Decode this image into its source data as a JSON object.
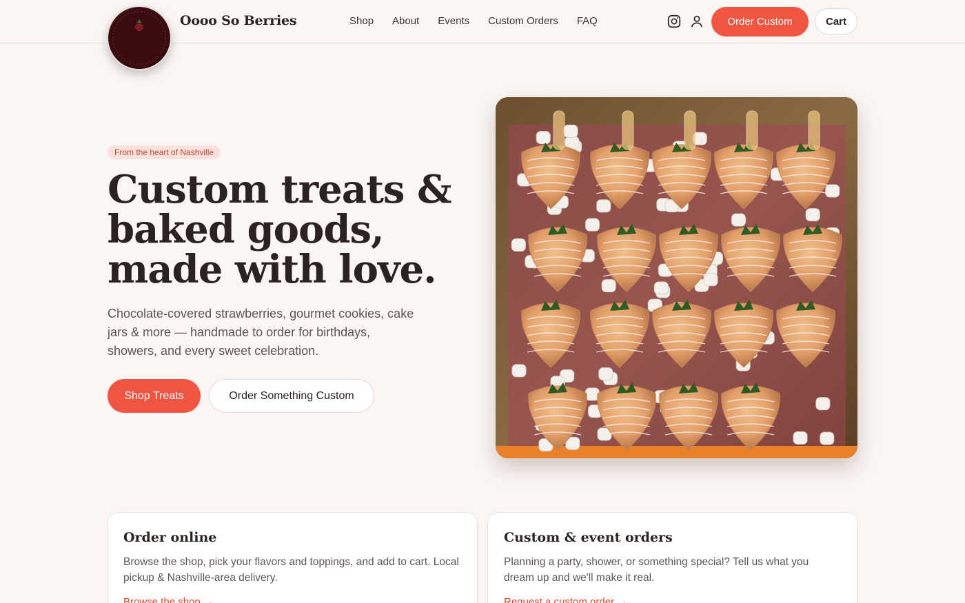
{
  "header": {
    "brand": "Oooo So Berries",
    "logo_text": "Oooo So Berry",
    "nav": [
      {
        "label": "Shop"
      },
      {
        "label": "About"
      },
      {
        "label": "Events"
      },
      {
        "label": "Custom Orders"
      },
      {
        "label": "FAQ"
      }
    ],
    "icons": [
      "instagram-icon",
      "user-icon"
    ],
    "order_custom_label": "Order Custom",
    "cart_label": "Cart"
  },
  "hero": {
    "badge": "From the heart of Nashville",
    "title_lines": [
      "Custom treats &",
      "baked goods,",
      "made with love."
    ],
    "description": "Chocolate-covered strawberries, gourmet cookies, cake jars & more — handmade to order for birthdays, showers, and every sweet celebration.",
    "primary_cta": "Shop Treats",
    "secondary_cta": "Order Something Custom"
  },
  "cards": [
    {
      "title": "Order online",
      "text": "Browse the shop, pick your flavors and toppings, and add to cart. Local pickup & Nashville-area delivery.",
      "link": "Browse the shop →"
    },
    {
      "title": "Custom & event orders",
      "text": "Planning a party, shower, or something special? Tell us what you dream up and we'll make it real.",
      "link": "Request a custom order →"
    }
  ],
  "colors": {
    "accent": "#ef5540",
    "background": "#fbf6f3",
    "text": "#2b2321"
  }
}
